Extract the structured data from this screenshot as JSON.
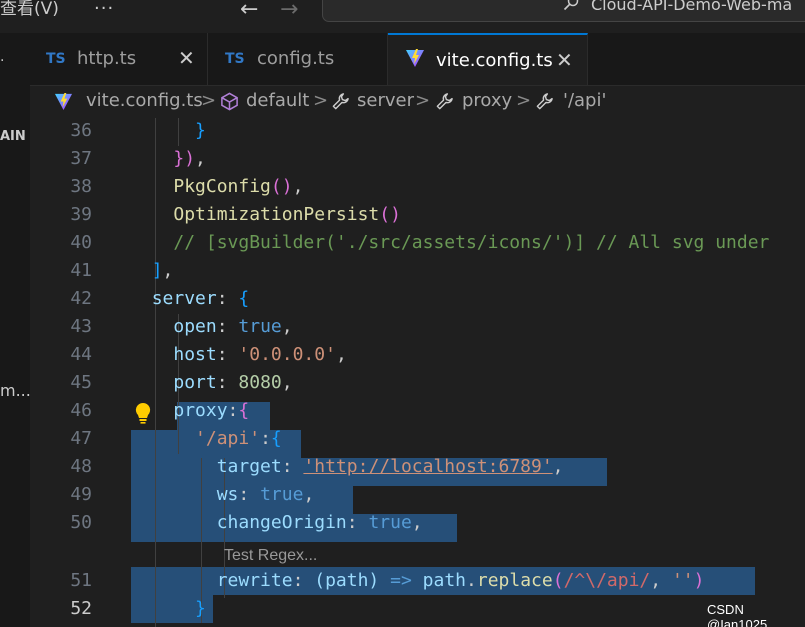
{
  "titlebar": {
    "menu_view": "查看(V)",
    "more": "···",
    "back": "←",
    "forward": "→",
    "command_center": "Cloud-API-Demo-Web-ma"
  },
  "sidebar": {
    "dot": "·",
    "section_label": "AIN",
    "item_label": "m..."
  },
  "tabs": [
    {
      "badge": "TS",
      "label": "http.ts",
      "close": "✕"
    },
    {
      "badge": "TS",
      "label": "config.ts"
    },
    {
      "label": "vite.config.ts",
      "close": "✕",
      "active": true
    }
  ],
  "breadcrumb": {
    "items": [
      "vite.config.ts",
      "default",
      "server",
      "proxy",
      "'/api'"
    ],
    "separator": ">"
  },
  "editor": {
    "line_numbers": [
      "36",
      "37",
      "38",
      "39",
      "40",
      "41",
      "42",
      "43",
      "44",
      "45",
      "46",
      "47",
      "48",
      "49",
      "50",
      "51",
      "52"
    ],
    "current_line": "52",
    "codelens": "Test Regex...",
    "tokens": {
      "l36_close": "}",
      "l37_paren": ")",
      "l37_brace": "}",
      "l37_comma": ",",
      "pkg": "PkgConfig",
      "pkg_parens": "()",
      "opt": "OptimizationPersist",
      "opt_parens": "()",
      "comment": "// [svgBuilder('./src/assets/icons/')] // All svg under",
      "l41_bracket": "]",
      "server": "server",
      "open": "open",
      "true": "true",
      "host": "host",
      "host_val": "'0.0.0.0'",
      "port": "port",
      "port_val": "8080",
      "proxy": "proxy",
      "api_key": "'/api'",
      "target": "target",
      "target_val": "'http://localhost:6789'",
      "ws": "ws",
      "change_origin": "changeOrigin",
      "rewrite": "rewrite",
      "path_param": "(path)",
      "arrow": "=>",
      "path": "path",
      "replace": "replace",
      "regex": "/^\\/api/",
      "empty_str": "''",
      "colon": ":",
      "comma": ",",
      "dot": ".",
      "open_brace": "{",
      "close_brace": "}",
      "open_paren": "(",
      "close_paren": ")"
    }
  },
  "watermark": "CSDN @Ian1025",
  "colors": {
    "background": "#1f1f1f",
    "selection": "#264f78",
    "accent": "#0078d4",
    "ts_badge": "#3178c6"
  }
}
